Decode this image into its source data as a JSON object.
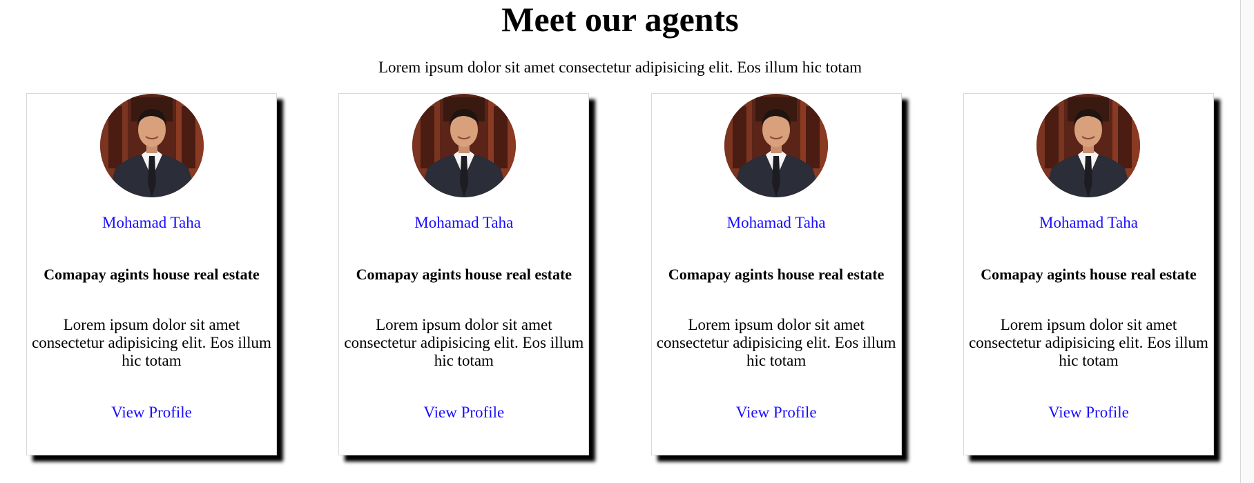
{
  "header": {
    "title": "Meet our agents",
    "subtitle": "Lorem ipsum dolor sit amet consectetur adipisicing elit. Eos illum hic totam"
  },
  "colors": {
    "link": "#1a0dff",
    "card_shadow": "#000000"
  },
  "agents": [
    {
      "name": "Mohamad Taha",
      "company": "Comapay agints house real estate",
      "bio": "Lorem ipsum dolor sit amet consectetur adipisicing elit. Eos illum hic totam",
      "link_label": "View Profile",
      "photo_icon": "agent-photo"
    },
    {
      "name": "Mohamad Taha",
      "company": "Comapay agints house real estate",
      "bio": "Lorem ipsum dolor sit amet consectetur adipisicing elit. Eos illum hic totam",
      "link_label": "View Profile",
      "photo_icon": "agent-photo"
    },
    {
      "name": "Mohamad Taha",
      "company": "Comapay agints house real estate",
      "bio": "Lorem ipsum dolor sit amet consectetur adipisicing elit. Eos illum hic totam",
      "link_label": "View Profile",
      "photo_icon": "agent-photo"
    },
    {
      "name": "Mohamad Taha",
      "company": "Comapay agints house real estate",
      "bio": "Lorem ipsum dolor sit amet consectetur adipisicing elit. Eos illum hic totam",
      "link_label": "View Profile",
      "photo_icon": "agent-photo"
    }
  ]
}
